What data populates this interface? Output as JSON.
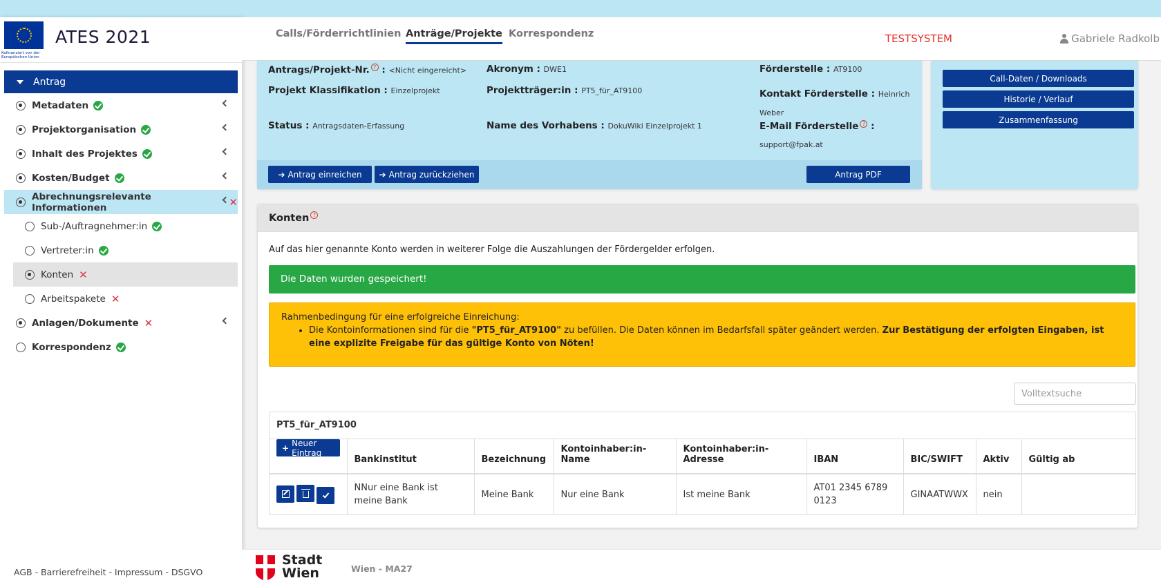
{
  "brand": {
    "eu_caption": "Kofinanziert von der Europäischen Union",
    "app_title": "ATES 2021"
  },
  "sidebar": {
    "header": "Antrag",
    "items": [
      {
        "label": "Metadaten",
        "status": "ok"
      },
      {
        "label": "Projektorganisation",
        "status": "ok"
      },
      {
        "label": "Inhalt des Projektes",
        "status": "ok"
      },
      {
        "label": "Kosten/Budget",
        "status": "ok"
      },
      {
        "label": "Abrechnungsrelevante Informationen",
        "status": "error"
      }
    ],
    "sub_items": [
      {
        "label": "Sub-/Auftragnehmer:in",
        "status": "ok"
      },
      {
        "label": "Vertreter:in",
        "status": "ok"
      },
      {
        "label": "Konten",
        "status": "error"
      },
      {
        "label": "Arbeitspakete",
        "status": "error"
      }
    ],
    "items_after": [
      {
        "label": "Anlagen/Dokumente",
        "status": "error"
      },
      {
        "label": "Korrespondenz",
        "status": "ok"
      }
    ],
    "footer": "AGB - Barrierefreiheit - Impressum - DSGVO"
  },
  "topnav": {
    "tabs": [
      "Calls/Förderrichtlinien",
      "Anträge/Projekte",
      "Korrespondenz"
    ],
    "active_tab": "Anträge/Projekte",
    "testsystem": "TESTSYSTEM",
    "user": "Gabriele Radkolb"
  },
  "info": {
    "antrag_nr_label": "Antrags/Projekt-Nr.",
    "antrag_nr_value": "<Nicht eingereicht>",
    "akronym_label": "Akronym :",
    "akronym_value": "DWE1",
    "foerderstelle_label": "Förderstelle :",
    "foerderstelle_value": "AT9100",
    "klassifikation_label": "Projekt Klassifikation :",
    "klassifikation_value": "Einzelprojekt",
    "projekttraeger_label": "Projektträger:in :",
    "projekttraeger_value": "PT5_für_AT9100",
    "kontakt_label": "Kontakt Förderstelle :",
    "kontakt_value_1": "Heinrich",
    "kontakt_value_2": "Weber",
    "status_label": "Status :",
    "status_value": "Antragsdaten-Erfassung",
    "vorhaben_label": "Name des Vorhabens :",
    "vorhaben_value": "DokuWiki Einzelprojekt 1",
    "email_label": "E-Mail Förderstelle",
    "email_value": "support@fpak.at",
    "btn_einreichen": "Antrag einreichen",
    "btn_zurueckziehen": "Antrag zurückziehen",
    "btn_pdf": "Antrag PDF"
  },
  "side_actions": [
    "Call-Daten / Downloads",
    "Historie / Verlauf",
    "Zusammenfassung"
  ],
  "konten": {
    "title": "Konten",
    "intro": "Auf das hier genannte Konto werden in weiterer Folge die Auszahlungen der Fördergelder erfolgen.",
    "success": "Die Daten wurden gespeichert!",
    "warn_title": "Rahmenbedingung für eine erfolgreiche Einreichung:",
    "warn_pre": "Die Kontoinformationen sind für die ",
    "warn_bold_name": "\"PT5_für_AT9100\"",
    "warn_mid": " zu befüllen. Die Daten können im Bedarfsfall später geändert werden. ",
    "warn_bold_end": "Zur Bestätigung der erfolgten Eingaben, ist eine explizite Freigabe für das gültige Konto von Nöten!",
    "search_placeholder": "Volltextsuche",
    "table_title": "PT5_für_AT9100",
    "new_entry": "Neuer Eintrag",
    "columns": [
      "Bankinstitut",
      "Bezeichnung",
      "Kontoinhaber:in-Name",
      "Kontoinhaber:in-Adresse",
      "IBAN",
      "BIC/SWIFT",
      "Aktiv",
      "Gültig ab"
    ],
    "rows": [
      {
        "bank": "NNur eine Bank ist meine Bank",
        "bezeichnung": "Meine Bank",
        "name": "Nur eine Bank",
        "adresse": "Ist meine Bank",
        "iban": "AT01 2345 6789 0123",
        "bic": "GINAATWWX",
        "aktiv": "nein",
        "gueltig": ""
      }
    ]
  },
  "footer": {
    "city_line1": "Stadt",
    "city_line2": "Wien",
    "dept": "Wien - MA27"
  },
  "colors": {
    "primary": "#0a3a91",
    "info_bg": "#bde6f5",
    "success": "#28a745",
    "warning": "#ffc107",
    "error": "#dc3545",
    "testsystem": "#e8302f"
  }
}
